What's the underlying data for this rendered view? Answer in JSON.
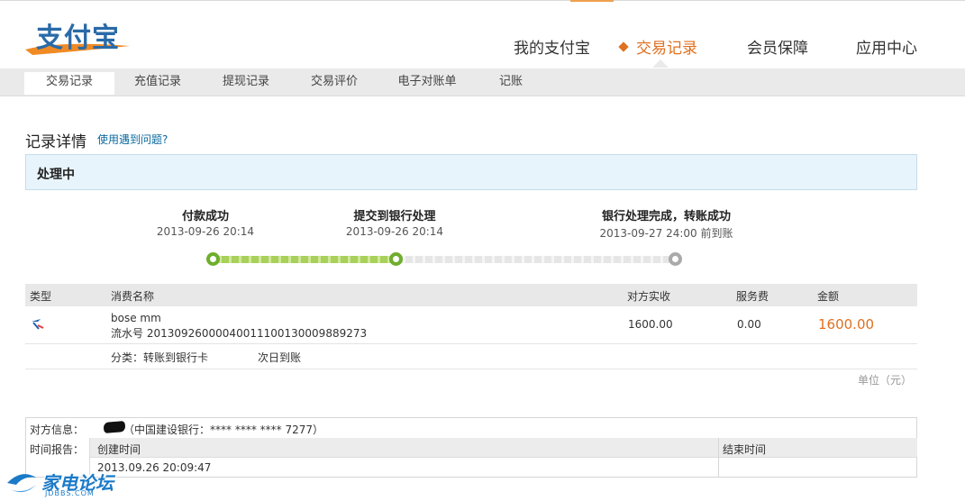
{
  "brand": {
    "logo_text": "支付宝"
  },
  "main_nav": [
    {
      "label": "我的支付宝",
      "active": false
    },
    {
      "label": "交易记录",
      "active": true
    },
    {
      "label": "会员保障",
      "active": false
    },
    {
      "label": "应用中心",
      "active": false
    }
  ],
  "sub_nav": [
    {
      "label": "交易记录",
      "active": true
    },
    {
      "label": "充值记录",
      "active": false
    },
    {
      "label": "提现记录",
      "active": false
    },
    {
      "label": "交易评价",
      "active": false
    },
    {
      "label": "电子对账单",
      "active": false
    },
    {
      "label": "记账",
      "active": false
    }
  ],
  "record": {
    "title": "记录详情",
    "help_link": "使用遇到问题?",
    "status": "处理中"
  },
  "steps": [
    {
      "title": "付款成功",
      "time": "2013-09-26 20:14",
      "state": "done"
    },
    {
      "title": "提交到银行处理",
      "time": "2013-09-26 20:14",
      "state": "done"
    },
    {
      "title": "银行处理完成，转账成功",
      "time": "2013-09-27 24:00 前到账",
      "state": "todo"
    }
  ],
  "table": {
    "headers": {
      "type": "类型",
      "name": "消费名称",
      "received": "对方实收",
      "fee": "服务费",
      "amount": "金额"
    },
    "row": {
      "type_icon": "transfer-icon",
      "name": "bose mm",
      "serial": "流水号  20130926000040011100130009889273",
      "received": "1600.00",
      "fee": "0.00",
      "amount": "1600.00"
    },
    "category": "分类：转账到银行卡",
    "arrival": "次日到账",
    "unit": "单位（元）"
  },
  "info": {
    "counterparty_label": "对方信息：",
    "counterparty_value": "（中国建设银行：**** **** **** 7277）",
    "time_label": "时间报告：",
    "created_header": "创建时间",
    "ended_header": "结束时间",
    "created_value": "2013.09.26 20:09:47",
    "ended_value": ""
  },
  "watermark": {
    "text": "家电论坛",
    "sub": "JDBBS.COM"
  },
  "colors": {
    "accent": "#e07020",
    "link": "#0a6aa0",
    "brand_blue": "#2a6aa8",
    "progress_done": "#6fae2c"
  }
}
